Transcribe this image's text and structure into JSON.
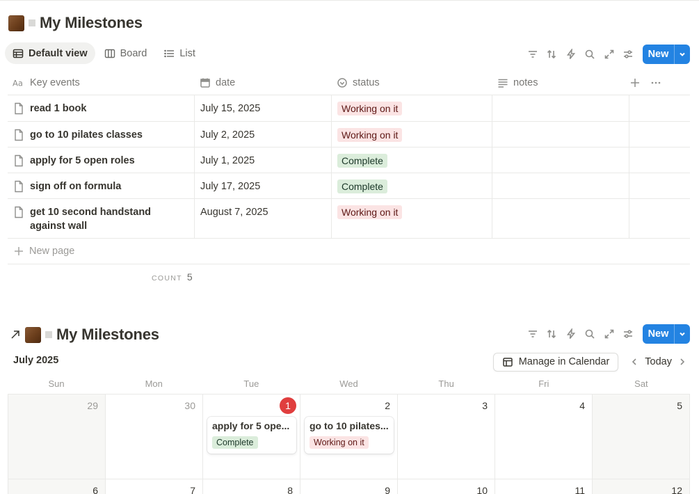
{
  "database_title": "My Milestones",
  "tabs": [
    {
      "label": "Default view",
      "active": true,
      "icon": "table-icon"
    },
    {
      "label": "Board",
      "active": false,
      "icon": "board-icon"
    },
    {
      "label": "List",
      "active": false,
      "icon": "list-icon"
    }
  ],
  "toolbar": {
    "icons": [
      "filter-icon",
      "sort-icon",
      "automation-icon",
      "search-icon",
      "expand-icon",
      "settings-icon"
    ],
    "new_label": "New"
  },
  "table": {
    "columns": [
      {
        "label": "Key events",
        "icon": "text-type-icon"
      },
      {
        "label": "date",
        "icon": "calendar-icon"
      },
      {
        "label": "status",
        "icon": "status-icon"
      },
      {
        "label": "notes",
        "icon": "notes-icon"
      }
    ],
    "rows": [
      {
        "name": "read 1 book",
        "date": "July 15, 2025",
        "status": "Working on it",
        "status_color": "red",
        "notes": ""
      },
      {
        "name": "go to 10 pilates classes",
        "date": "July 2, 2025",
        "status": "Working on it",
        "status_color": "red",
        "notes": ""
      },
      {
        "name": "apply for 5 open roles",
        "date": "July 1, 2025",
        "status": "Complete",
        "status_color": "green",
        "notes": ""
      },
      {
        "name": "sign off on formula",
        "date": "July 17, 2025",
        "status": "Complete",
        "status_color": "green",
        "notes": ""
      },
      {
        "name": "get 10 second handstand against wall",
        "date": "August 7, 2025",
        "status": "Working on it",
        "status_color": "red",
        "notes": ""
      }
    ],
    "new_page_label": "New page",
    "count_label": "COUNT",
    "count_value": "5"
  },
  "calendar": {
    "title": "My Milestones",
    "month_label": "July 2025",
    "manage_label": "Manage in Calendar",
    "today_label": "Today",
    "weekdays": [
      "Sun",
      "Mon",
      "Tue",
      "Wed",
      "Thu",
      "Fri",
      "Sat"
    ],
    "week1": [
      "29",
      "30",
      "1",
      "2",
      "3",
      "4",
      "5"
    ],
    "week2": [
      "6",
      "7",
      "8",
      "9",
      "10",
      "11",
      "12"
    ],
    "events": {
      "tue": {
        "title": "apply for 5 ope...",
        "status": "Complete"
      },
      "wed": {
        "title": "go to 10 pilates...",
        "status": "Working on it"
      }
    }
  },
  "colors": {
    "accent": "#2383e2",
    "today_badge": "#e03e3e",
    "working_bg": "#fbe4e4",
    "complete_bg": "#dbeddb"
  }
}
